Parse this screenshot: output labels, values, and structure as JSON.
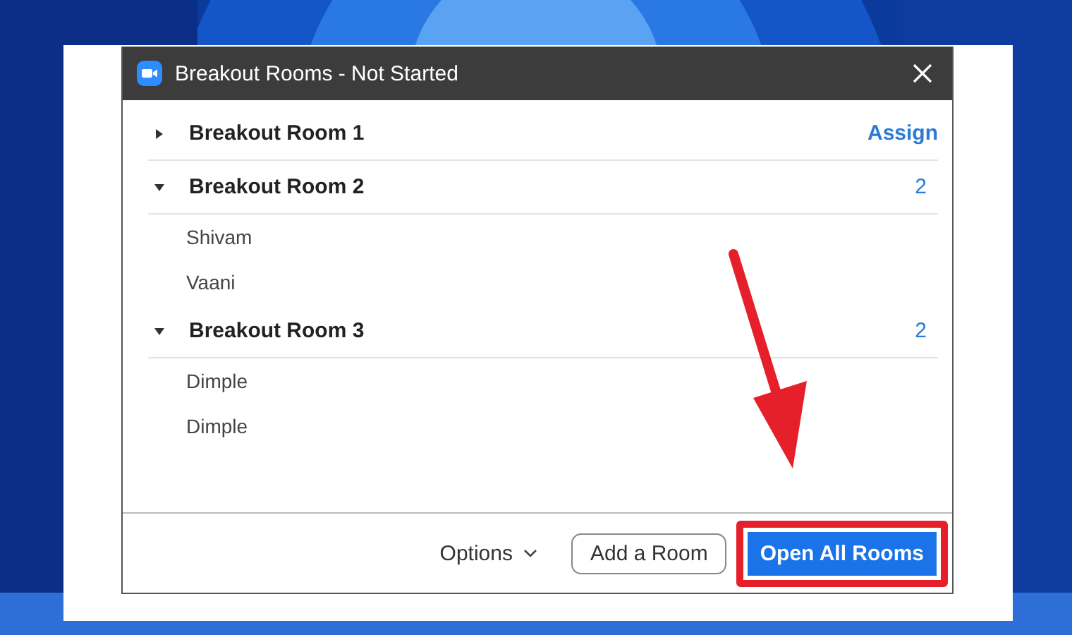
{
  "window": {
    "title": "Breakout Rooms - Not Started"
  },
  "rooms": [
    {
      "name": "Breakout Room 1",
      "expanded": false,
      "action": "Assign"
    },
    {
      "name": "Breakout Room 2",
      "expanded": true,
      "count": "2",
      "members": [
        "Shivam",
        "Vaani"
      ]
    },
    {
      "name": "Breakout Room 3",
      "expanded": true,
      "count": "2",
      "members": [
        "Dimple",
        "Dimple"
      ]
    }
  ],
  "footer": {
    "options": "Options",
    "add_button": "Add a Room",
    "open_button": "Open All Rooms"
  }
}
